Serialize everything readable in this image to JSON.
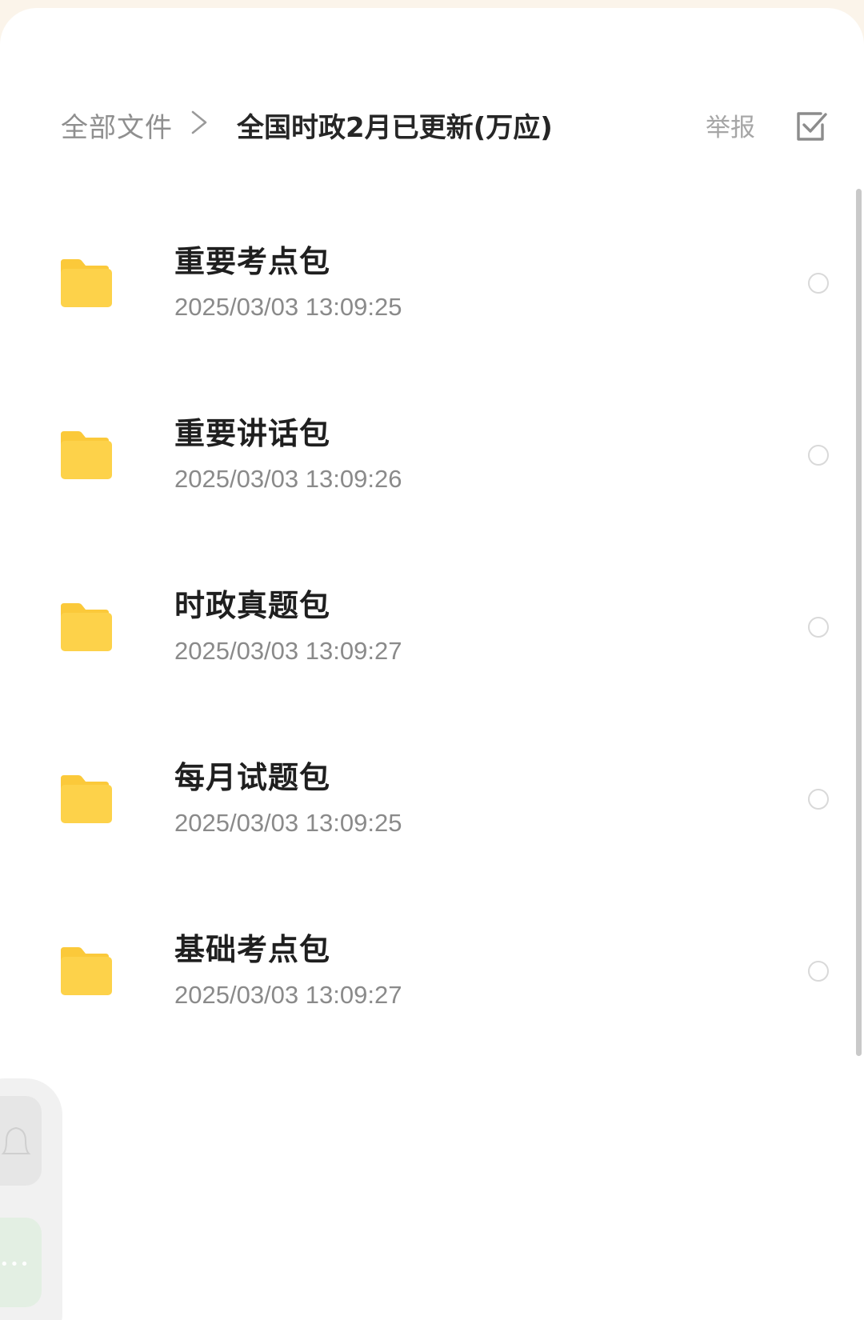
{
  "breadcrumb": {
    "root": "全部文件",
    "separator_icon": "chevron-right-icon",
    "current": "全国时政2月已更新(万应)"
  },
  "actions": {
    "report_label": "举报",
    "select_icon": "checkbox-select-icon"
  },
  "files": [
    {
      "name": "重要考点包",
      "date": "2025/03/03  13:09:25",
      "icon": "folder-icon"
    },
    {
      "name": "重要讲话包",
      "date": "2025/03/03  13:09:26",
      "icon": "folder-icon"
    },
    {
      "name": "时政真题包",
      "date": "2025/03/03  13:09:27",
      "icon": "folder-icon"
    },
    {
      "name": "每月试题包",
      "date": "2025/03/03  13:09:25",
      "icon": "folder-icon"
    },
    {
      "name": "基础考点包",
      "date": "2025/03/03  13:09:27",
      "icon": "folder-icon"
    }
  ],
  "colors": {
    "folder": "#fdd24a",
    "folder_tab": "#fbc93a",
    "accent_bg": "#fbf4ea",
    "text_primary": "#1f1f1f",
    "text_secondary": "#8a8a8a"
  }
}
